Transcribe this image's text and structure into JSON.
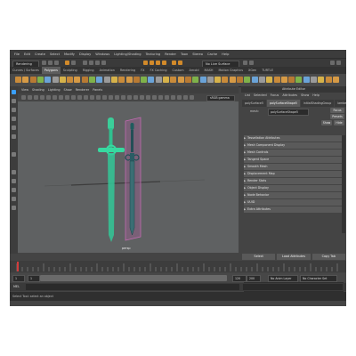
{
  "menubar": [
    "File",
    "Edit",
    "Create",
    "Select",
    "Modify",
    "Display",
    "Windows",
    "Lighting/Shading",
    "Texturing",
    "Render",
    "Toon",
    "Stereo",
    "Cache",
    "Help"
  ],
  "status": {
    "workspace": "Rendering",
    "live_surface": "No Live Surface"
  },
  "shelf_tabs": [
    "Curves / Surfaces",
    "Polygons",
    "Sculpting",
    "Rigging",
    "Animation",
    "Rendering",
    "FX",
    "FX Caching",
    "Custom",
    "Arnold",
    "MASH",
    "Motion Graphics",
    "XGen",
    "TURTLE"
  ],
  "shelf_active_tab": 1,
  "viewport": {
    "menu": [
      "View",
      "Shading",
      "Lighting",
      "Show",
      "Renderer",
      "Panels"
    ],
    "colorspace": "sRGB gamma",
    "camera_label": "persp",
    "colors": {
      "background": "#5f6162",
      "sword_green": "#37d9a0",
      "sword_dark": "#1f5c5e",
      "selection": "#c06ab0"
    }
  },
  "attribute_editor": {
    "title": "Attribute Editor",
    "menu": [
      "List",
      "Selected",
      "Focus",
      "Attributes",
      "Show",
      "Help"
    ],
    "tabs": [
      "polySurface5",
      "polySurfaceShape5",
      "initialShadingGroup",
      "lambert1"
    ],
    "active_tab": 1,
    "node_label": "mesh:",
    "node_name": "polySurfaceShape5",
    "focus_label": "Focus",
    "presets_label": "Presets",
    "show_label": "Show",
    "hide_label": "Hide",
    "sections": [
      "Tessellation Attributes",
      "Mesh Component Display",
      "Mesh Controls",
      "Tangent Space",
      "Smooth Mesh",
      "Displacement Map",
      "Render Stats",
      "Object Display",
      "Node Behavior",
      "UUID",
      "Extra Attributes"
    ],
    "notes_label": "Notes: polySurfaceShape5",
    "buttons": [
      "Select",
      "Load Attributes",
      "Copy Tab"
    ]
  },
  "timeline": {
    "start": "1",
    "range_start": "1",
    "range_end": "120",
    "end": "120",
    "end2": "200",
    "layer": "No Anim Layer",
    "character": "No Character Set",
    "current_frame": "1"
  },
  "command_line": {
    "language": "MEL"
  },
  "help_line": "Select Tool: select an object"
}
